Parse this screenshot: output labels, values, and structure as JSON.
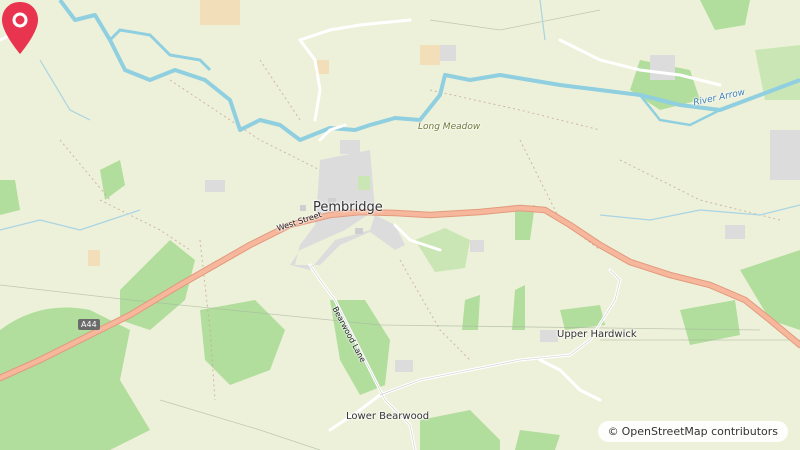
{
  "map": {
    "place_labels": {
      "town": "Pembridge",
      "village_upper_hardwick": "Upper Hardwick",
      "village_lower_bearwood": "Lower Bearwood",
      "area_long_meadow": "Long Meadow"
    },
    "water_labels": {
      "river": "River Arrow"
    },
    "road_labels": {
      "west_street": "West Street",
      "bearwood_lane": "Bearwood Lane",
      "a44_shield": "A44"
    },
    "marker": {
      "icon": "map-pin-icon",
      "color": "#e8344e"
    },
    "attribution": {
      "symbol": "©",
      "text": "OpenStreetMap contributors"
    },
    "colors": {
      "land": "#eef1d9",
      "woodland": "#aedc9a",
      "primary_road": "#f3a98e",
      "river": "#8fcfe0",
      "built_up": "#dcdcdc"
    }
  }
}
